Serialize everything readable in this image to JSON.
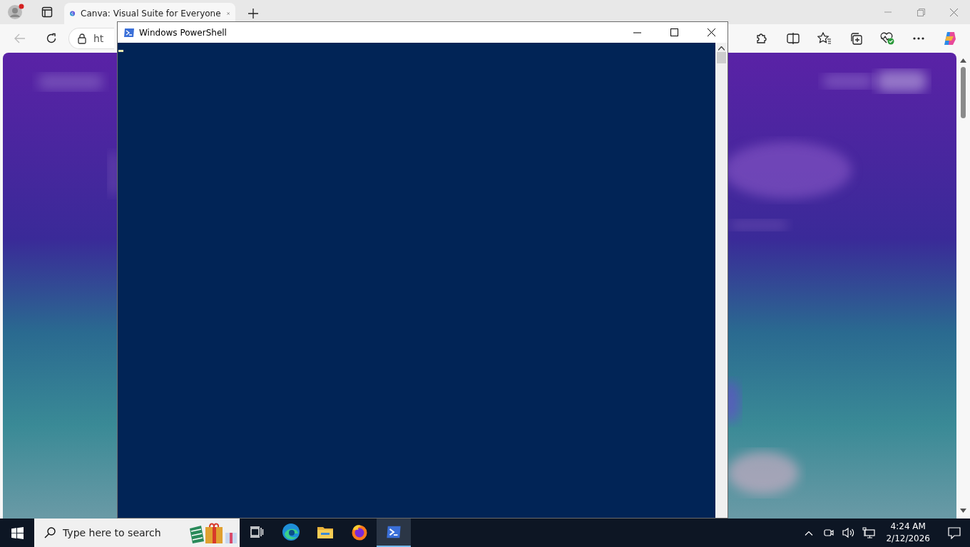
{
  "browser": {
    "tabs": [
      {
        "title": "Canva: Visual Suite for Everyone",
        "selected": true
      }
    ],
    "address": {
      "value": "ht"
    }
  },
  "powershell_window": {
    "title": "Windows PowerShell"
  },
  "taskbar": {
    "search": {
      "placeholder": "Type here to search"
    },
    "apps": [
      {
        "kind": "task-view",
        "selected": false
      },
      {
        "kind": "edge",
        "selected": false
      },
      {
        "kind": "explorer",
        "selected": false
      },
      {
        "kind": "firefox",
        "selected": false
      },
      {
        "kind": "powershell",
        "selected": true
      }
    ],
    "clock": {
      "time": "4:24 AM",
      "date": "2/12/2026"
    }
  }
}
